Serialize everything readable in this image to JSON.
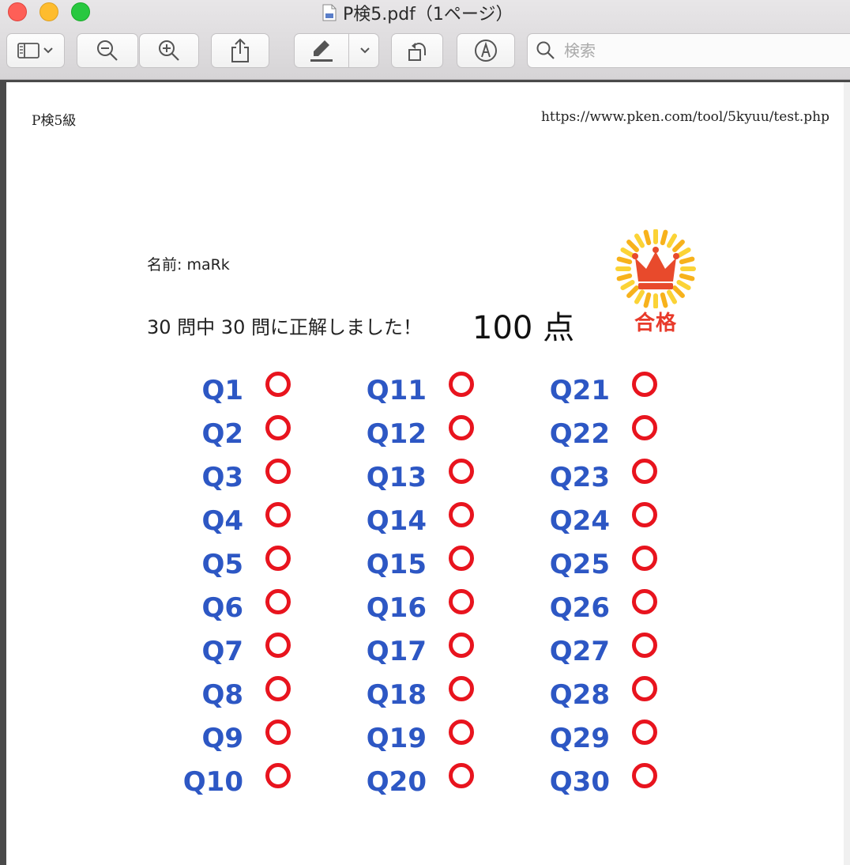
{
  "window": {
    "title": "P検5.pdf（1ページ）"
  },
  "toolbar": {
    "search_placeholder": "検索"
  },
  "document": {
    "header_left": "P検5級",
    "header_right": "https://www.pken.com/tool/5kyuu/test.php",
    "name_line": "名前: maRk",
    "score_line": "30 問中 30 問に正解しました！",
    "score_points": "100 点",
    "pass_label": "合格",
    "questions": [
      {
        "label": "Q1",
        "mark": "○"
      },
      {
        "label": "Q2",
        "mark": "○"
      },
      {
        "label": "Q3",
        "mark": "○"
      },
      {
        "label": "Q4",
        "mark": "○"
      },
      {
        "label": "Q5",
        "mark": "○"
      },
      {
        "label": "Q6",
        "mark": "○"
      },
      {
        "label": "Q7",
        "mark": "○"
      },
      {
        "label": "Q8",
        "mark": "○"
      },
      {
        "label": "Q9",
        "mark": "○"
      },
      {
        "label": "Q10",
        "mark": "○"
      },
      {
        "label": "Q11",
        "mark": "○"
      },
      {
        "label": "Q12",
        "mark": "○"
      },
      {
        "label": "Q13",
        "mark": "○"
      },
      {
        "label": "Q14",
        "mark": "○"
      },
      {
        "label": "Q15",
        "mark": "○"
      },
      {
        "label": "Q16",
        "mark": "○"
      },
      {
        "label": "Q17",
        "mark": "○"
      },
      {
        "label": "Q18",
        "mark": "○"
      },
      {
        "label": "Q19",
        "mark": "○"
      },
      {
        "label": "Q20",
        "mark": "○"
      },
      {
        "label": "Q21",
        "mark": "○"
      },
      {
        "label": "Q22",
        "mark": "○"
      },
      {
        "label": "Q23",
        "mark": "○"
      },
      {
        "label": "Q24",
        "mark": "○"
      },
      {
        "label": "Q25",
        "mark": "○"
      },
      {
        "label": "Q26",
        "mark": "○"
      },
      {
        "label": "Q27",
        "mark": "○"
      },
      {
        "label": "Q28",
        "mark": "○"
      },
      {
        "label": "Q29",
        "mark": "○"
      },
      {
        "label": "Q30",
        "mark": "○"
      }
    ]
  },
  "colors": {
    "question_label": "#2d57c4",
    "correct_mark": "#e8141e",
    "pass_label": "#e83a2a"
  },
  "icons": [
    "sidebar-toggle-icon",
    "chevron-down-icon",
    "zoom-out-icon",
    "zoom-in-icon",
    "share-icon",
    "highlighter-icon",
    "rotate-icon",
    "markup-icon",
    "search-icon",
    "crown-icon",
    "pdf-document-icon"
  ]
}
